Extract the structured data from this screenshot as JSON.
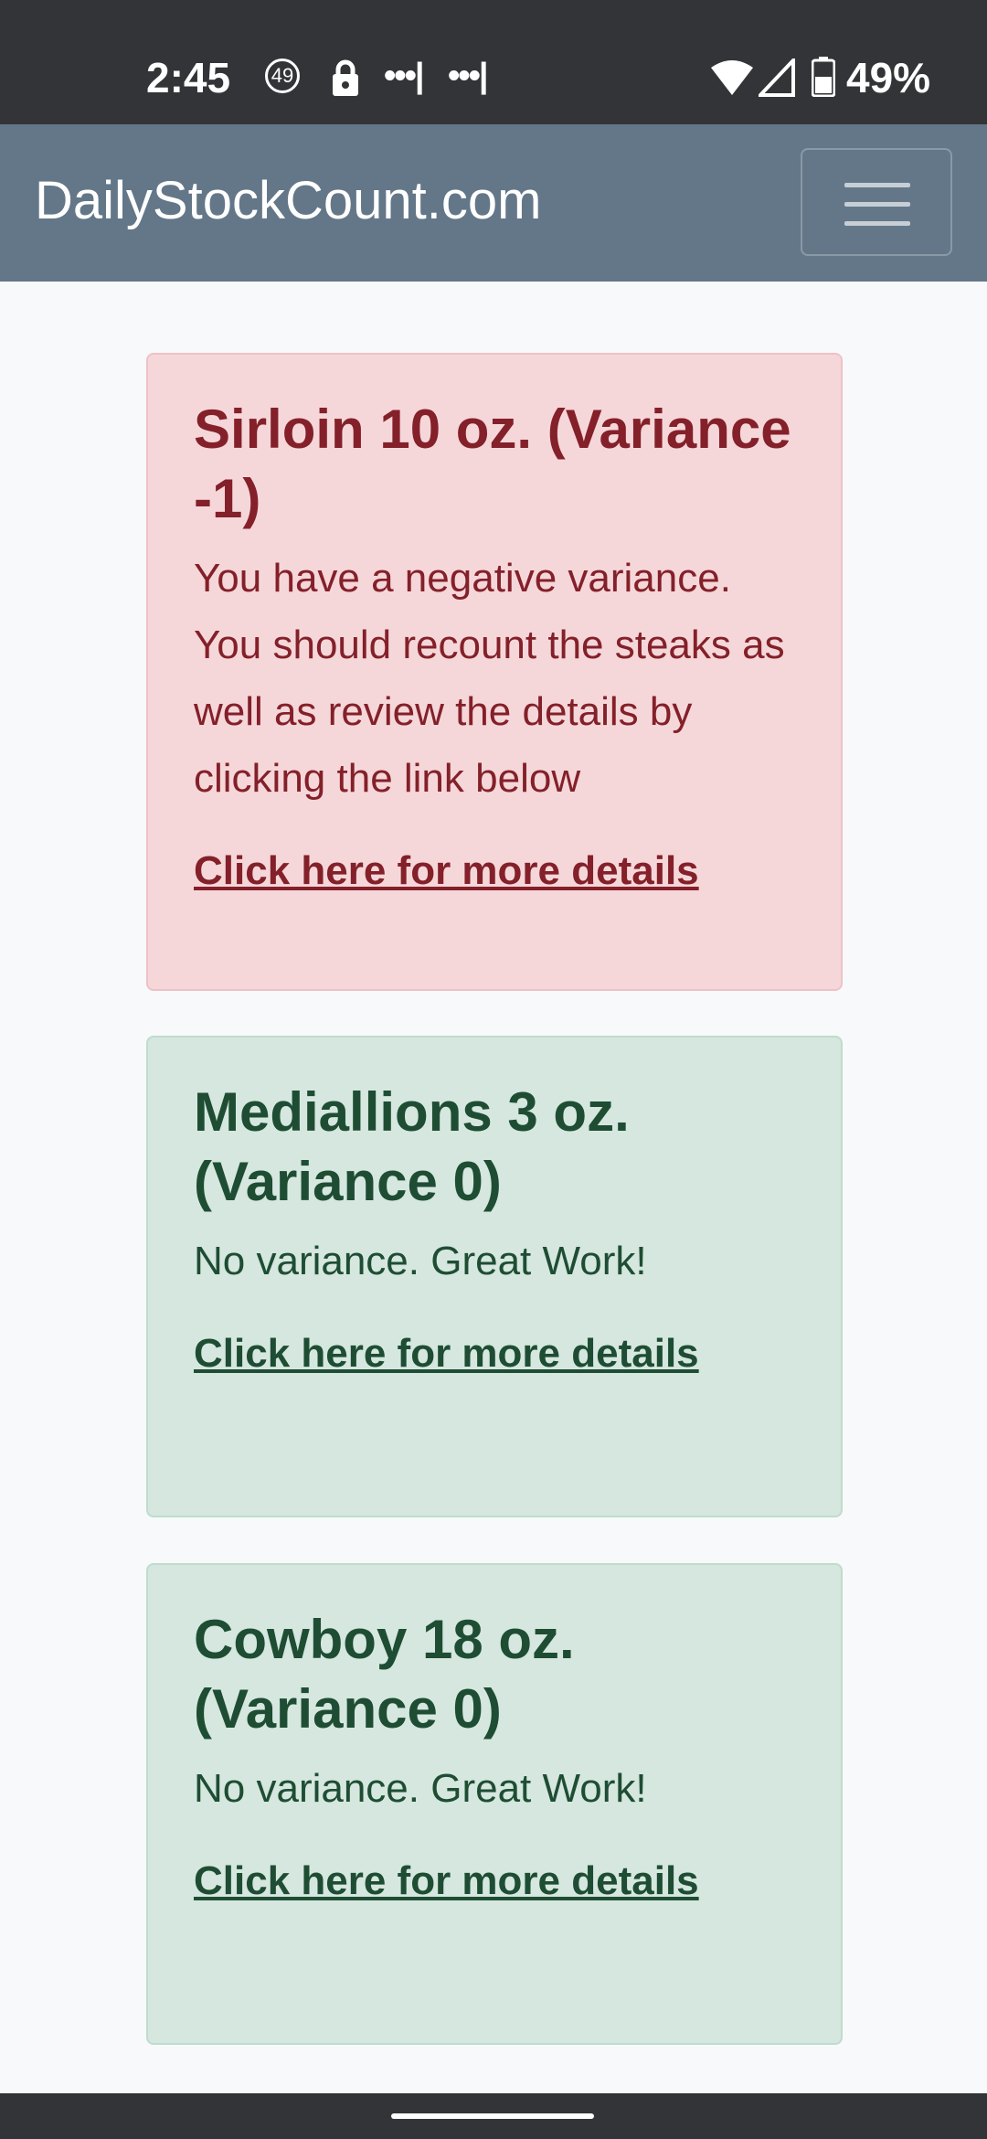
{
  "status_bar": {
    "time": "2:45",
    "notification_count": "49",
    "battery_percent": "49%"
  },
  "navbar": {
    "brand": "DailyStockCount.com"
  },
  "cards": [
    {
      "variant": "danger",
      "title": "Sirloin 10 oz. (Variance -1)",
      "message": "You have a negative variance. You should recount the steaks as well as review the details by clicking the link below",
      "link": "Click here for more details"
    },
    {
      "variant": "success",
      "title": "Mediallions 3 oz. (Variance 0)",
      "message": "No variance. Great Work!",
      "link": "Click here for more details"
    },
    {
      "variant": "success",
      "title": "Cowboy 18 oz. (Variance 0)",
      "message": "No variance. Great Work!",
      "link": "Click here for more details"
    }
  ],
  "colors": {
    "navbar": "#637789",
    "danger_bg": "#f5d7da",
    "danger_text": "#842029",
    "success_bg": "#d5e7de",
    "success_text": "#1e4d34"
  }
}
